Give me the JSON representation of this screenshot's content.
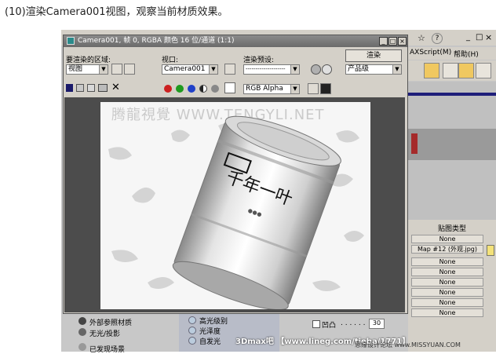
{
  "caption": "(10)渲染Camera001视图，观察当前材质效果。",
  "window": {
    "title": "Camera001, 帧 0, RGBA 颜色 16 位/通道 (1:1)",
    "controls": [
      "_",
      "□",
      "×"
    ]
  },
  "render_area": {
    "label": "要渲染的区域:",
    "value": "视图"
  },
  "viewport": {
    "label": "视口:",
    "value": "Camera001"
  },
  "preset": {
    "label": "渲染预设:",
    "value": "--------------------"
  },
  "render_button": "渲染",
  "quality": {
    "value": "产品级"
  },
  "channel": {
    "value": "RGB Alpha"
  },
  "toolbar_icons": [
    "save-icon",
    "copy-icon",
    "clone-icon",
    "print-icon",
    "clear-icon"
  ],
  "channel_colors": {
    "red": "#cc2020",
    "green": "#1e9a1e",
    "blue": "#2040c8"
  },
  "watermark": "腾龍視覺 WWW.TENGYLI.NET",
  "canister": {
    "brand": "千年一叶",
    "subtitle": "●●●"
  },
  "background_app": {
    "menu": [
      "AXScript(M)",
      "帮助(H)"
    ],
    "map_type_header": "贴图类型",
    "map_rows": [
      "None",
      "Map #12 (外观.jpg)",
      "None",
      "None",
      "None",
      "None",
      "None",
      "None"
    ],
    "materials": [
      "外部参照材质",
      "无光/投影",
      "已发现场景"
    ],
    "shader_options": [
      "高光级别",
      "光泽度",
      "自发光"
    ],
    "bump": {
      "label": "凹凸",
      "value": "30"
    }
  },
  "credit_stamp": "3Dmax吧 【www.lineg.com/tieba/1771】",
  "site_mark": "思缘设计论坛 www.MISSYUAN.COM"
}
